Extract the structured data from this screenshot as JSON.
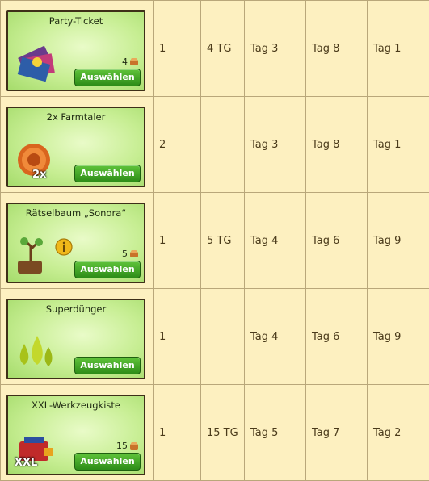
{
  "rows": [
    {
      "item": "Party-Ticket",
      "price": "4",
      "icon": "party-ticket-icon",
      "button": "Auswählen",
      "c2": "1",
      "c3": "4 TG",
      "c4": "Tag 3",
      "c5": "Tag 8",
      "c6": "Tag 1"
    },
    {
      "item": "2x Farmtaler",
      "price": "",
      "icon": "farmtaler-coin-icon",
      "badge": "2x",
      "button": "Auswählen",
      "c2": "2",
      "c3": "",
      "c4": "Tag 3",
      "c5": "Tag 8",
      "c6": "Tag 1"
    },
    {
      "item": "Rätselbaum „Sonora“",
      "price": "5",
      "icon": "riddle-tree-icon",
      "button": "Auswählen",
      "c2": "1",
      "c3": "5 TG",
      "c4": "Tag 4",
      "c5": "Tag 6",
      "c6": "Tag 9"
    },
    {
      "item": "Superdünger",
      "price": "",
      "icon": "fertilizer-drops-icon",
      "button": "Auswählen",
      "c2": "1",
      "c3": "",
      "c4": "Tag 4",
      "c5": "Tag 6",
      "c6": "Tag 9"
    },
    {
      "item": "XXL-Werkzeugkiste",
      "price": "15",
      "icon": "toolbox-icon",
      "badge": "XXL",
      "button": "Auswählen",
      "c2": "1",
      "c3": "15 TG",
      "c4": "Tag 5",
      "c5": "Tag 7",
      "c6": "Tag 2"
    }
  ]
}
